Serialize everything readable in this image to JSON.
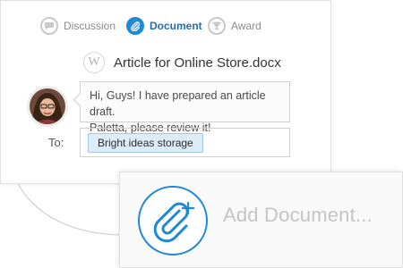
{
  "tabs": [
    {
      "label": "Discussion",
      "icon": "discussion-icon",
      "active": false
    },
    {
      "label": "Document",
      "icon": "paperclip-icon",
      "active": true
    },
    {
      "label": "Award",
      "icon": "trophy-icon",
      "active": false
    }
  ],
  "document": {
    "badge": "W",
    "title": "Article for Online Store.docx"
  },
  "comment": {
    "line1": "Hi, Guys! I have prepared an article draft.",
    "line2": "Paletta, please review it!"
  },
  "recipient": {
    "label": "To:",
    "tag": "Bright ideas storage"
  },
  "add_document": {
    "label": "Add Document..."
  },
  "colors": {
    "accent": "#1f8ad6",
    "tag_bg": "#dcecf9",
    "muted_text": "#c4c4c4"
  }
}
